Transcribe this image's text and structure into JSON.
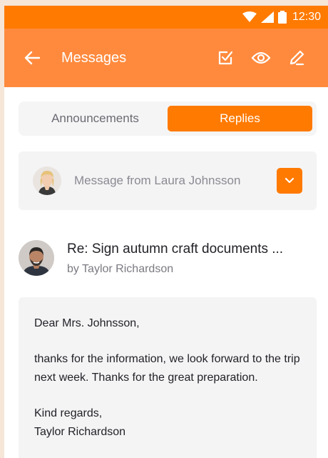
{
  "status_bar": {
    "time": "12:30",
    "icons": [
      "wifi-icon",
      "signal-icon",
      "battery-icon"
    ]
  },
  "app_bar": {
    "title": "Messages",
    "back_icon": "arrow-left-icon",
    "actions": [
      "checkbox-icon",
      "eye-icon",
      "pencil-icon"
    ]
  },
  "tabs": [
    {
      "label": "Announcements",
      "active": false
    },
    {
      "label": "Replies",
      "active": true
    }
  ],
  "filter": {
    "label": "Message from Laura Johnsson",
    "icon": "chevron-down-icon"
  },
  "message": {
    "subject": "Re: Sign autumn craft documents ...",
    "author": "by Taylor Richardson",
    "greeting": "Dear Mrs. Johnsson,",
    "body": "thanks for the information, we look forward to the trip next week. Thanks for the great preparation.",
    "closing": "Kind regards,",
    "signature": "Taylor Richardson"
  },
  "colors": {
    "accent": "#ff7a00",
    "appbar": "#ff8a3d",
    "card": "#f4f4f5"
  }
}
